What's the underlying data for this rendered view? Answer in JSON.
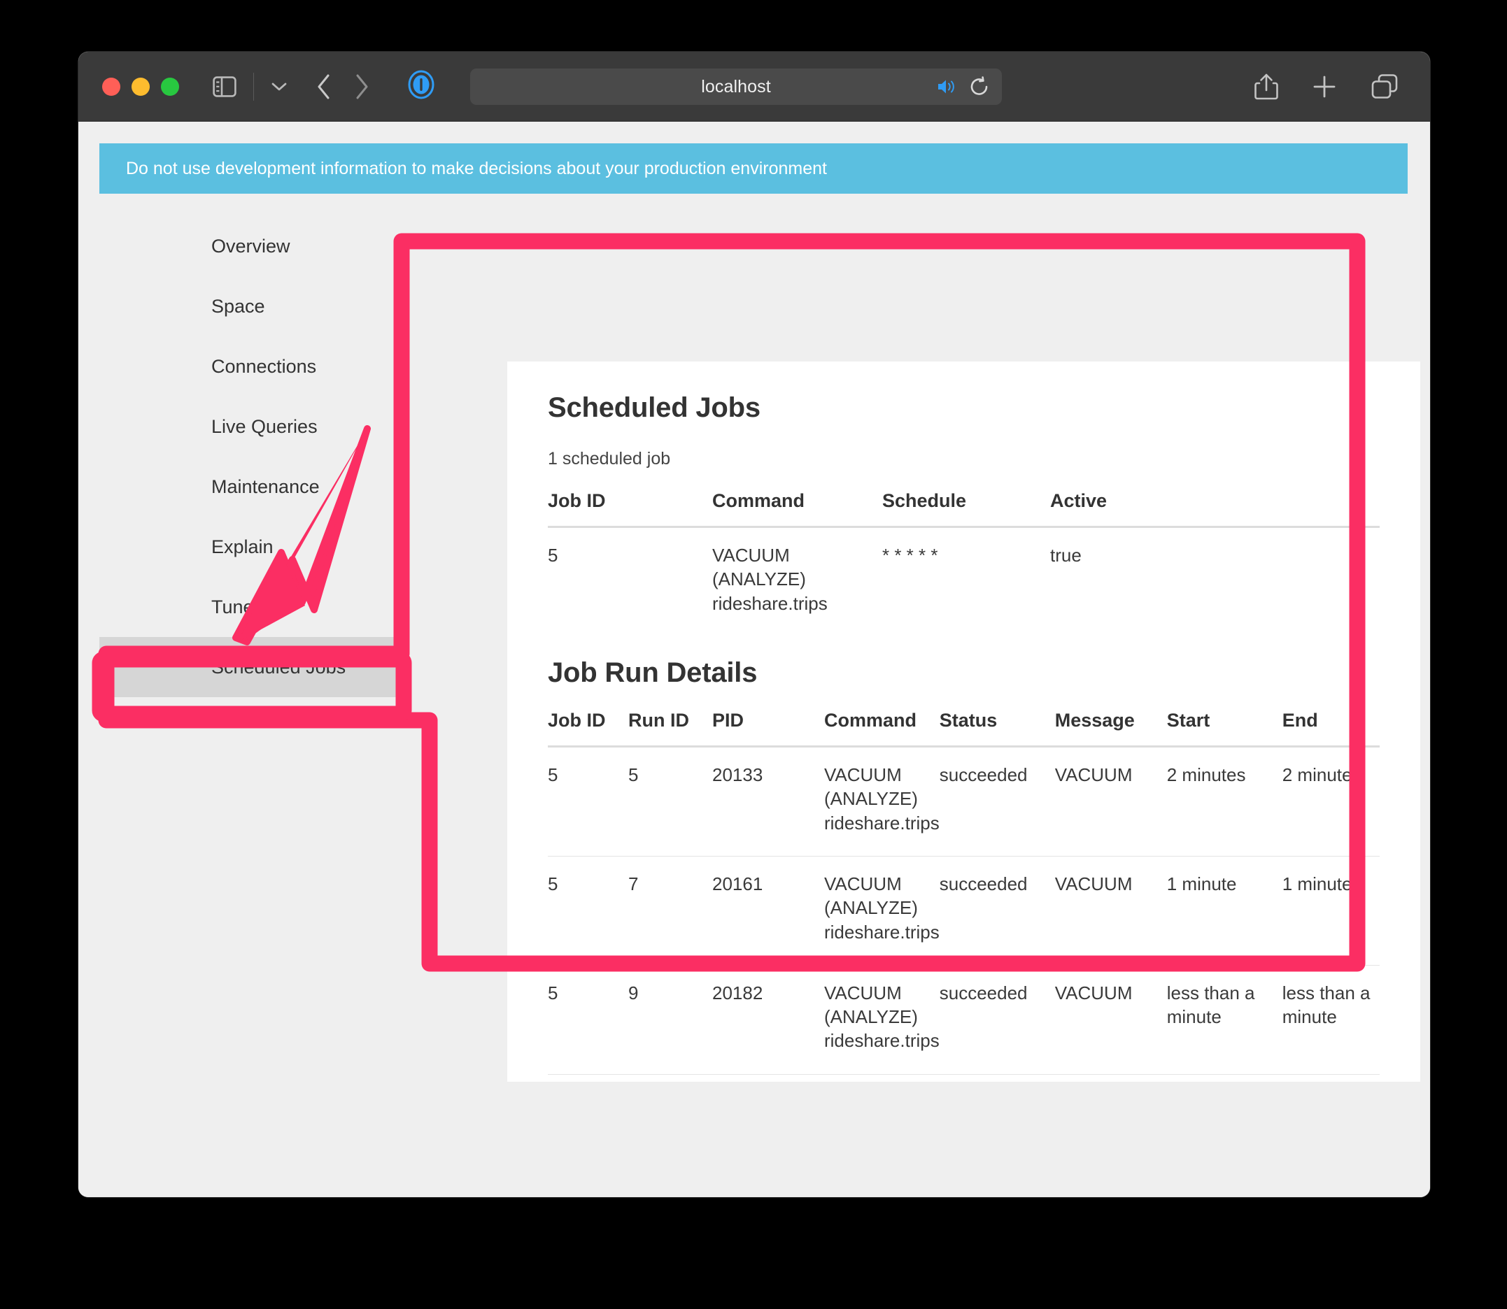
{
  "browser": {
    "url": "localhost",
    "icons": {
      "traffic_close": "close-window-icon",
      "traffic_minimize": "minimize-window-icon",
      "traffic_zoom": "zoom-window-icon",
      "sidebar": "sidebar-toggle-icon",
      "sidebar_menu": "chevron-down-icon",
      "back": "back-chevron-icon",
      "forward": "forward-chevron-icon",
      "extension": "onepassword-shield-icon",
      "audio": "speaker-playing-icon",
      "reload": "reload-icon",
      "share": "share-icon",
      "new_tab": "plus-icon",
      "tab_overview": "tab-overview-icon"
    }
  },
  "banner": {
    "text": "Do not use development information to make decisions about your production environment",
    "color": "#5bbfe0"
  },
  "sidebar": {
    "items": [
      {
        "label": "Overview",
        "active": false
      },
      {
        "label": "Space",
        "active": false
      },
      {
        "label": "Connections",
        "active": false
      },
      {
        "label": "Live Queries",
        "active": false
      },
      {
        "label": "Maintenance",
        "active": false
      },
      {
        "label": "Explain",
        "active": false
      },
      {
        "label": "Tune",
        "active": false
      },
      {
        "label": "Scheduled Jobs",
        "active": true
      }
    ]
  },
  "main": {
    "scheduled_jobs": {
      "title": "Scheduled Jobs",
      "count_text": "1 scheduled job",
      "columns": [
        "Job ID",
        "Command",
        "Schedule",
        "Active"
      ],
      "rows": [
        {
          "job_id": "5",
          "command": "VACUUM (ANALYZE) rideshare.trips",
          "schedule": "* * * * *",
          "active": "true"
        }
      ]
    },
    "job_run_details": {
      "title": "Job Run Details",
      "columns": [
        "Job ID",
        "Run ID",
        "PID",
        "Command",
        "Status",
        "Message",
        "Start",
        "End"
      ],
      "rows": [
        {
          "job_id": "5",
          "run_id": "5",
          "pid": "20133",
          "command": "VACUUM (ANALYZE) rideshare.trips",
          "status": "succeeded",
          "message": "VACUUM",
          "start": "2 minutes",
          "end": "2 minutes"
        },
        {
          "job_id": "5",
          "run_id": "7",
          "pid": "20161",
          "command": "VACUUM (ANALYZE) rideshare.trips",
          "status": "succeeded",
          "message": "VACUUM",
          "start": "1 minute",
          "end": "1 minute"
        },
        {
          "job_id": "5",
          "run_id": "9",
          "pid": "20182",
          "command": "VACUUM (ANALYZE) rideshare.trips",
          "status": "succeeded",
          "message": "VACUUM",
          "start": "less than a minute",
          "end": "less than a minute"
        }
      ]
    }
  },
  "annotations": {
    "color": "#fb2e63",
    "highlight_nav_item": "Scheduled Jobs",
    "highlight_region": "main-content-card",
    "arrow": "points-to-scheduled-jobs-nav-item"
  }
}
